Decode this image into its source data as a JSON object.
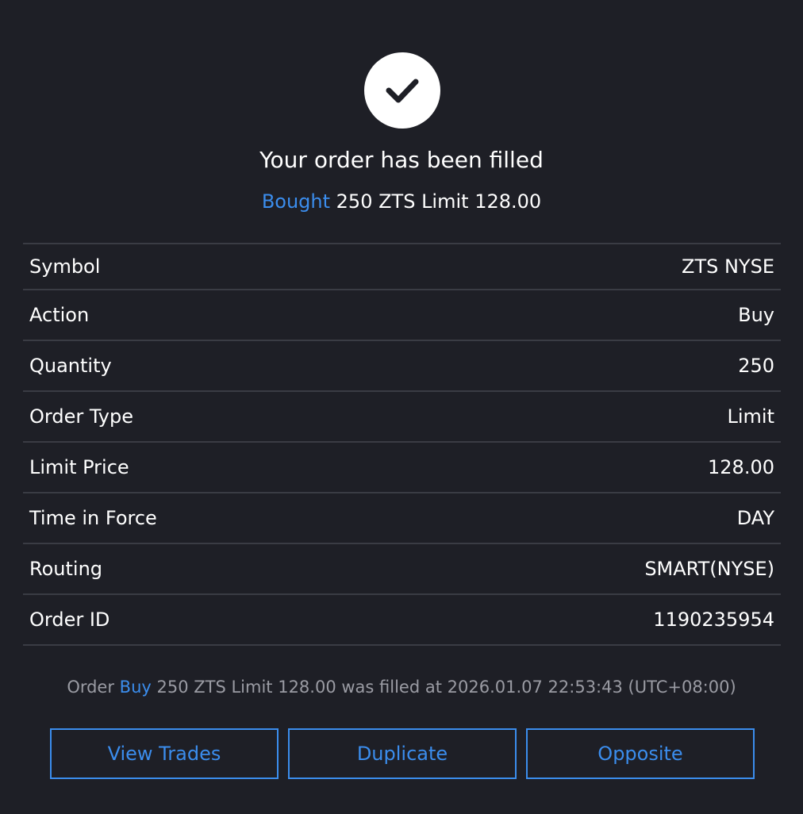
{
  "header": {
    "title": "Your order has been filled",
    "summary_action": "Bought",
    "summary_rest": " 250 ZTS Limit 128.00"
  },
  "details": [
    {
      "label": "Symbol",
      "value": "ZTS NYSE"
    },
    {
      "label": "Action",
      "value": "Buy"
    },
    {
      "label": "Quantity",
      "value": "250"
    },
    {
      "label": "Order Type",
      "value": "Limit"
    },
    {
      "label": "Limit Price",
      "value": "128.00"
    },
    {
      "label": "Time in Force",
      "value": "DAY"
    },
    {
      "label": "Routing",
      "value": "SMART(NYSE)"
    },
    {
      "label": "Order ID",
      "value": "1190235954"
    }
  ],
  "footnote": {
    "prefix": "Order ",
    "action": "Buy",
    "rest": " 250 ZTS Limit 128.00 was filled at 2026.01.07 22:53:43 (UTC+08:00)"
  },
  "buttons": {
    "view_trades": "View Trades",
    "duplicate": "Duplicate",
    "opposite": "Opposite"
  },
  "icons": {
    "status": "checkmark-icon"
  },
  "colors": {
    "background": "#1e1f26",
    "accent": "#3b8ded",
    "divider": "#3a3c44",
    "muted_text": "#9a9ba3"
  }
}
